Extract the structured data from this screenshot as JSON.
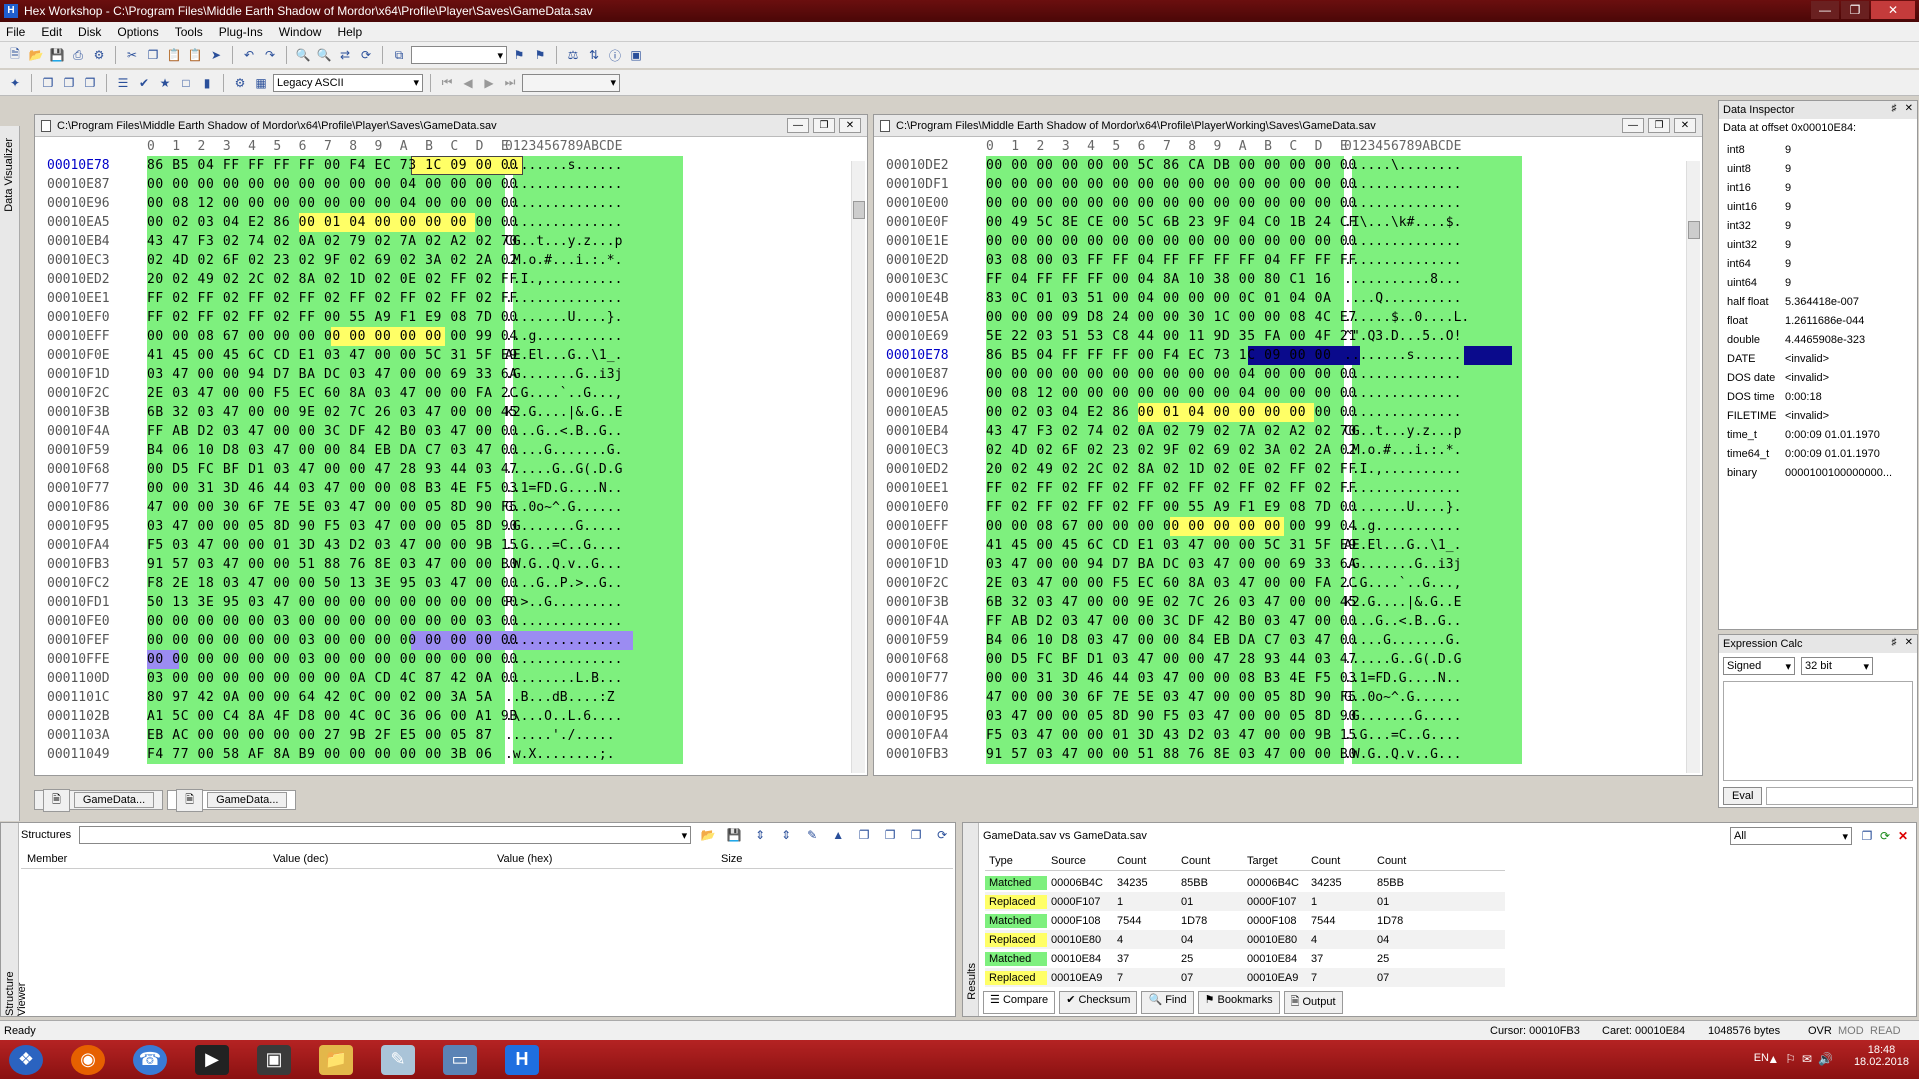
{
  "window": {
    "title": "Hex Workshop - C:\\Program Files\\Middle Earth Shadow of Mordor\\x64\\Profile\\Player\\Saves\\GameData.sav"
  },
  "menu": [
    "File",
    "Edit",
    "Disk",
    "Options",
    "Tools",
    "Plug-Ins",
    "Window",
    "Help"
  ],
  "toolbar": {
    "encoding": "Legacy ASCII"
  },
  "left_panel_label": "Data Visualizer",
  "hex1": {
    "title": "C:\\Program Files\\Middle Earth Shadow of Mordor\\x64\\Profile\\Player\\Saves\\GameData.sav",
    "header_hex": "0  1  2  3  4  5  6  7  8  9  A  B  C  D  E",
    "header_ascii": "0123456789ABCDE",
    "rows": [
      {
        "off": "00010E78",
        "hex": "86 B5 04 FF FF FF FF 00 F4 EC 73 1C 09 00 00",
        "asc": "........s......"
      },
      {
        "off": "00010E87",
        "hex": "00 00 00 00 00 00 00 00 00 00 04 00 00 00 00",
        "asc": "..............."
      },
      {
        "off": "00010E96",
        "hex": "00 08 12 00 00 00 00 00 00 00 04 00 00 00 00",
        "asc": "..............."
      },
      {
        "off": "00010EA5",
        "hex": "00 02 03 04 E2 86 00 01 04 00 00 00 00 00 00",
        "asc": "..............."
      },
      {
        "off": "00010EB4",
        "hex": "43 47 F3 02 74 02 0A 02 79 02 7A 02 A2 02 70",
        "asc": "CG..t...y.z...p"
      },
      {
        "off": "00010EC3",
        "hex": "02 4D 02 6F 02 23 02 9F 02 69 02 3A 02 2A 02",
        "asc": ".M.o.#...i.:.*."
      },
      {
        "off": "00010ED2",
        "hex": "20 02 49 02 2C 02 8A 02 1D 02 0E 02 FF 02 FF",
        "asc": " .I.,.........."
      },
      {
        "off": "00010EE1",
        "hex": "FF 02 FF 02 FF 02 FF 02 FF 02 FF 02 FF 02 FF",
        "asc": "..............."
      },
      {
        "off": "00010EF0",
        "hex": "FF 02 FF 02 FF 02 FF 00 55 A9 F1 E9 08 7D 00",
        "asc": "........U....}."
      },
      {
        "off": "00010EFF",
        "hex": "00 00 08 67 00 00 00 00 00 00 00 00 00 99 04",
        "asc": "...g..........."
      },
      {
        "off": "00010F0E",
        "hex": "41 45 00 45 6C CD E1 03 47 00 00 5C 31 5F E9",
        "asc": "AE.El...G..\\1_."
      },
      {
        "off": "00010F1D",
        "hex": "03 47 00 00 94 D7 BA DC 03 47 00 00 69 33 6A",
        "asc": ".G.......G..i3j"
      },
      {
        "off": "00010F2C",
        "hex": "2E 03 47 00 00 F5 EC 60 8A 03 47 00 00 FA 2C",
        "asc": "..G....`..G...,"
      },
      {
        "off": "00010F3B",
        "hex": "6B 32 03 47 00 00 9E 02 7C 26 03 47 00 00 45",
        "asc": "k2.G....|&.G..E"
      },
      {
        "off": "00010F4A",
        "hex": "FF AB D2 03 47 00 00 3C DF 42 B0 03 47 00 00",
        "asc": "....G..<.B..G.."
      },
      {
        "off": "00010F59",
        "hex": "B4 06 10 D8 03 47 00 00 84 EB DA C7 03 47 00",
        "asc": ".....G.......G."
      },
      {
        "off": "00010F68",
        "hex": "00 D5 FC BF D1 03 47 00 00 47 28 93 44 03 47",
        "asc": "......G..G(.D.G"
      },
      {
        "off": "00010F77",
        "hex": "00 00 31 3D 46 44 03 47 00 00 08 B3 4E F5 03",
        "asc": "..1=FD.G....N.."
      },
      {
        "off": "00010F86",
        "hex": "47 00 00 30 6F 7E 5E 03 47 00 00 05 8D 90 F5",
        "asc": "G..0o~^.G......"
      },
      {
        "off": "00010F95",
        "hex": "03 47 00 00 05 8D 90 F5 03 47 00 00 05 8D 90",
        "asc": ".G.......G....."
      },
      {
        "off": "00010FA4",
        "hex": "F5 03 47 00 00 01 3D 43 D2 03 47 00 00 9B 15",
        "asc": "..G...=C..G...."
      },
      {
        "off": "00010FB3",
        "hex": "91 57 03 47 00 00 51 88 76 8E 03 47 00 00 B0",
        "asc": ".W.G..Q.v..G..."
      },
      {
        "off": "00010FC2",
        "hex": "F8 2E 18 03 47 00 00 50 13 3E 95 03 47 00 00",
        "asc": "....G..P.>..G.."
      },
      {
        "off": "00010FD1",
        "hex": "50 13 3E 95 03 47 00 00 00 00 00 00 00 00 00",
        "asc": "P.>..G........."
      },
      {
        "off": "00010FE0",
        "hex": "00 00 00 00 00 03 00 00 00 00 00 00 00 03 00",
        "asc": "..............."
      },
      {
        "off": "00010FEF",
        "hex": "00 00 00 00 00 00 03 00 00 00 00 00 00 00 00",
        "asc": "..............."
      },
      {
        "off": "00010FFE",
        "hex": "00 00 00 00 00 00 03 00 00 00 00 00 00 00 00",
        "asc": "..............."
      },
      {
        "off": "0001100D",
        "hex": "03 00 00 00 00 00 00 00 0A CD 4C 87 42 0A 00",
        "asc": ".........L.B..."
      },
      {
        "off": "0001101C",
        "hex": "80 97 42 0A 00 00 64 42 0C 00 02 00 3A 5A",
        "asc": "..B...dB....:Z"
      },
      {
        "off": "0001102B",
        "hex": "A1 5C 00 C4 8A 4F D8 00 4C 0C 36 06 00 A1 9B",
        "asc": ".\\...O..L.6...."
      },
      {
        "off": "0001103A",
        "hex": "EB AC 00 00 00 00 00 27 9B 2F E5 00 05 87",
        "asc": "......'./....."
      },
      {
        "off": "00011049",
        "hex": "F4 77 00 58 AF 8A B9 00 00 00 00 00 3B 06",
        "asc": ".w.X........;."
      }
    ]
  },
  "hex2": {
    "title": "C:\\Program Files\\Middle Earth Shadow of Mordor\\x64\\Profile\\PlayerWorking\\Saves\\GameData.sav",
    "header_hex": "0  1  2  3  4  5  6  7  8  9  A  B  C  D  E",
    "header_ascii": "0123456789ABCDE",
    "rows": [
      {
        "off": "00010DE2",
        "hex": "00 00 00 00 00 00 5C 86 CA DB 00 00 00 00 00",
        "asc": "......\\........"
      },
      {
        "off": "00010DF1",
        "hex": "00 00 00 00 00 00 00 00 00 00 00 00 00 00 00",
        "asc": "..............."
      },
      {
        "off": "00010E00",
        "hex": "00 00 00 00 00 00 00 00 00 00 00 00 00 00 00",
        "asc": "..............."
      },
      {
        "off": "00010E0F",
        "hex": "00 49 5C 8E CE 00 5C 6B 23 9F 04 C0 1B 24 CF",
        "asc": ".I\\...\\k#....$."
      },
      {
        "off": "00010E1E",
        "hex": "00 00 00 00 00 00 00 00 00 00 00 00 00 00 00",
        "asc": "..............."
      },
      {
        "off": "00010E2D",
        "hex": "03 08 00 03 FF FF 04 FF FF FF FF 04 FF FF FF",
        "asc": "..............."
      },
      {
        "off": "00010E3C",
        "hex": "FF 04 FF FF FF 00 04 8A 10 38 00 80 C1 16",
        "asc": "...........8..."
      },
      {
        "off": "00010E4B",
        "hex": "83 0C 01 03 51 00 04 00 00 00 0C 01 04 0A",
        "asc": "....Q.........."
      },
      {
        "off": "00010E5A",
        "hex": "00 00 00 09 D8 24 00 00 30 1C 00 00 08 4C E7",
        "asc": "......$..0....L."
      },
      {
        "off": "00010E69",
        "hex": "5E 22 03 51 53 C8 44 00 11 9D 35 FA 00 4F 21",
        "asc": "^\".Q3.D...5..O!"
      },
      {
        "off": "00010E78",
        "hex": "86 B5 04 FF FF FF 00 F4 EC 73 1C 09 00 00",
        "asc": "........s......"
      },
      {
        "off": "00010E87",
        "hex": "00 00 00 00 00 00 00 00 00 00 04 00 00 00 00",
        "asc": "..............."
      },
      {
        "off": "00010E96",
        "hex": "00 08 12 00 00 00 00 00 00 00 04 00 00 00 00",
        "asc": "..............."
      },
      {
        "off": "00010EA5",
        "hex": "00 02 03 04 E2 86 00 01 04 00 00 00 00 00 00",
        "asc": "..............."
      },
      {
        "off": "00010EB4",
        "hex": "43 47 F3 02 74 02 0A 02 79 02 7A 02 A2 02 70",
        "asc": "CG..t...y.z...p"
      },
      {
        "off": "00010EC3",
        "hex": "02 4D 02 6F 02 23 02 9F 02 69 02 3A 02 2A 02",
        "asc": ".M.o.#...i.:.*."
      },
      {
        "off": "00010ED2",
        "hex": "20 02 49 02 2C 02 8A 02 1D 02 0E 02 FF 02 FF",
        "asc": " .I.,.........."
      },
      {
        "off": "00010EE1",
        "hex": "FF 02 FF 02 FF 02 FF 02 FF 02 FF 02 FF 02 FF",
        "asc": "..............."
      },
      {
        "off": "00010EF0",
        "hex": "FF 02 FF 02 FF 02 FF 00 55 A9 F1 E9 08 7D 00",
        "asc": "........U....}."
      },
      {
        "off": "00010EFF",
        "hex": "00 00 08 67 00 00 00 00 00 00 00 00 00 99 04",
        "asc": "...g..........."
      },
      {
        "off": "00010F0E",
        "hex": "41 45 00 45 6C CD E1 03 47 00 00 5C 31 5F E9",
        "asc": "AE.El...G..\\1_."
      },
      {
        "off": "00010F1D",
        "hex": "03 47 00 00 94 D7 BA DC 03 47 00 00 69 33 6A",
        "asc": ".G.......G..i3j"
      },
      {
        "off": "00010F2C",
        "hex": "2E 03 47 00 00 F5 EC 60 8A 03 47 00 00 FA 2C",
        "asc": "..G....`..G...,"
      },
      {
        "off": "00010F3B",
        "hex": "6B 32 03 47 00 00 9E 02 7C 26 03 47 00 00 45",
        "asc": "k2.G....|&.G..E"
      },
      {
        "off": "00010F4A",
        "hex": "FF AB D2 03 47 00 00 3C DF 42 B0 03 47 00 00",
        "asc": "....G..<.B..G.."
      },
      {
        "off": "00010F59",
        "hex": "B4 06 10 D8 03 47 00 00 84 EB DA C7 03 47 00",
        "asc": ".....G.......G."
      },
      {
        "off": "00010F68",
        "hex": "00 D5 FC BF D1 03 47 00 00 47 28 93 44 03 47",
        "asc": "......G..G(.D.G"
      },
      {
        "off": "00010F77",
        "hex": "00 00 31 3D 46 44 03 47 00 00 08 B3 4E F5 03",
        "asc": "..1=FD.G....N.."
      },
      {
        "off": "00010F86",
        "hex": "47 00 00 30 6F 7E 5E 03 47 00 00 05 8D 90 F5",
        "asc": "G..0o~^.G......"
      },
      {
        "off": "00010F95",
        "hex": "03 47 00 00 05 8D 90 F5 03 47 00 00 05 8D 90",
        "asc": ".G.......G....."
      },
      {
        "off": "00010FA4",
        "hex": "F5 03 47 00 00 01 3D 43 D2 03 47 00 00 9B 15",
        "asc": "..G...=C..G...."
      },
      {
        "off": "00010FB3",
        "hex": "91 57 03 47 00 00 51 88 76 8E 03 47 00 00 B0",
        "asc": ".W.G..Q.v..G..."
      }
    ]
  },
  "tabs": [
    "GameData...",
    "GameData..."
  ],
  "inspector": {
    "title": "Data Inspector",
    "offset": "Data at offset 0x00010E84:",
    "rows": [
      [
        "int8",
        "9"
      ],
      [
        "uint8",
        "9"
      ],
      [
        "int16",
        "9"
      ],
      [
        "uint16",
        "9"
      ],
      [
        "int32",
        "9"
      ],
      [
        "uint32",
        "9"
      ],
      [
        "int64",
        "9"
      ],
      [
        "uint64",
        "9"
      ],
      [
        "half float",
        "5.364418e-007"
      ],
      [
        "float",
        "1.2611686e-044"
      ],
      [
        "double",
        "4.4465908e-323"
      ],
      [
        "DATE",
        "<invalid>"
      ],
      [
        "DOS date",
        "<invalid>"
      ],
      [
        "DOS time",
        "0:00:18"
      ],
      [
        "FILETIME",
        "<invalid>"
      ],
      [
        "time_t",
        "0:00:09 01.01.1970"
      ],
      [
        "time64_t",
        "0:00:09 01.01.1970"
      ],
      [
        "binary",
        "0000100100000000..."
      ]
    ]
  },
  "calc": {
    "title": "Expression Calc",
    "sign": "Signed",
    "bits": "32 bit",
    "eval": "Eval"
  },
  "structures": {
    "label": "Structures",
    "cols": [
      "Member",
      "Value (dec)",
      "Value (hex)",
      "Size"
    ],
    "side_label": "Structure Viewer"
  },
  "results": {
    "title": "GameData.sav vs GameData.sav",
    "filter": "All",
    "side_label": "Results",
    "cols": [
      "Type",
      "Source",
      "Count",
      "Count",
      "Target",
      "Count",
      "Count"
    ],
    "rows": [
      [
        "Matched",
        "00006B4C",
        "34235",
        "85BB",
        "00006B4C",
        "34235",
        "85BB"
      ],
      [
        "Replaced",
        "0000F107",
        "1",
        "01",
        "0000F107",
        "1",
        "01"
      ],
      [
        "Matched",
        "0000F108",
        "7544",
        "1D78",
        "0000F108",
        "7544",
        "1D78"
      ],
      [
        "Replaced",
        "00010E80",
        "4",
        "04",
        "00010E80",
        "4",
        "04"
      ],
      [
        "Matched",
        "00010E84",
        "37",
        "25",
        "00010E84",
        "37",
        "25"
      ],
      [
        "Replaced",
        "00010EA9",
        "7",
        "07",
        "00010EA9",
        "7",
        "07"
      ]
    ],
    "tabs": [
      "Compare",
      "Checksum",
      "Find",
      "Bookmarks",
      "Output"
    ]
  },
  "status": {
    "ready": "Ready",
    "cursor": "Cursor: 00010FB3",
    "caret": "Caret: 00010E84",
    "size": "1048576 bytes",
    "ovr": "OVR",
    "mod": "MOD",
    "read": "READ"
  },
  "taskbar": {
    "lang": "EN",
    "time": "18:48",
    "date": "18.02.2018"
  },
  "colors": {
    "green": "#7ef07e",
    "yellow": "#ffff66",
    "blue": "#0a0a8c",
    "purple": "#9b8cf2",
    "matched": "#7ef07e",
    "replaced": "#ffff66"
  }
}
